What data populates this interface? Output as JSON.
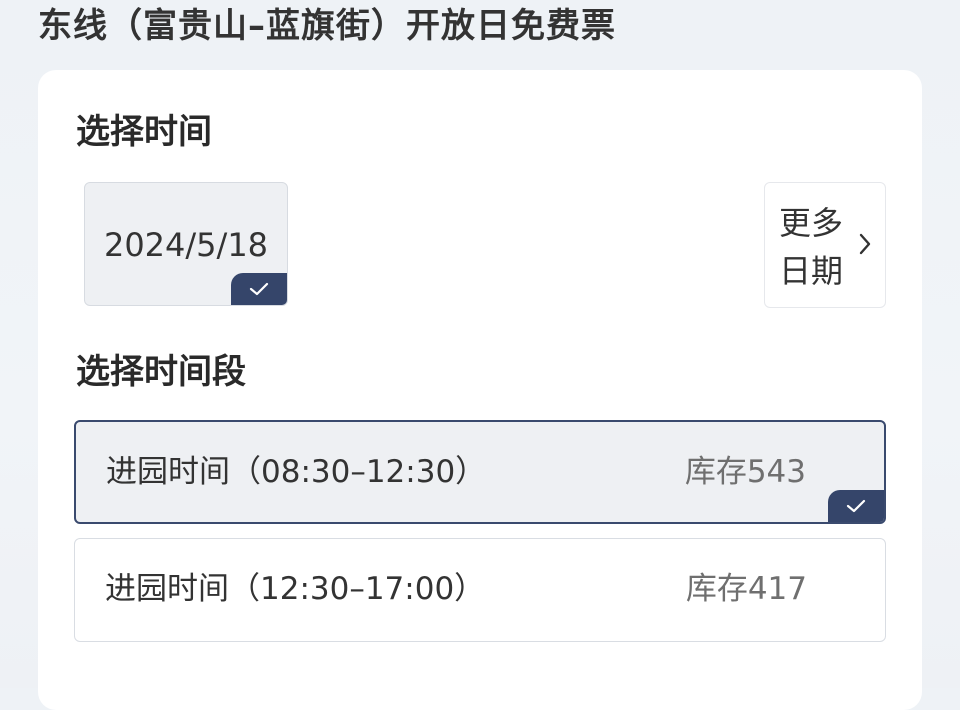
{
  "header": {
    "title": "东线（富贵山–蓝旗街）开放日免费票"
  },
  "date_section": {
    "title": "选择时间",
    "selected_date": "2024/5/18",
    "more_line1": "更多",
    "more_line2": "日期"
  },
  "slot_section": {
    "title": "选择时间段",
    "slots": [
      {
        "label": "进园时间（08:30–12:30）",
        "stock": "库存543",
        "selected": true
      },
      {
        "label": "进园时间（12:30–17:00）",
        "stock": "库存417",
        "selected": false
      }
    ]
  },
  "colors": {
    "accent": "#35456a",
    "selected_bg": "#eef0f3"
  }
}
